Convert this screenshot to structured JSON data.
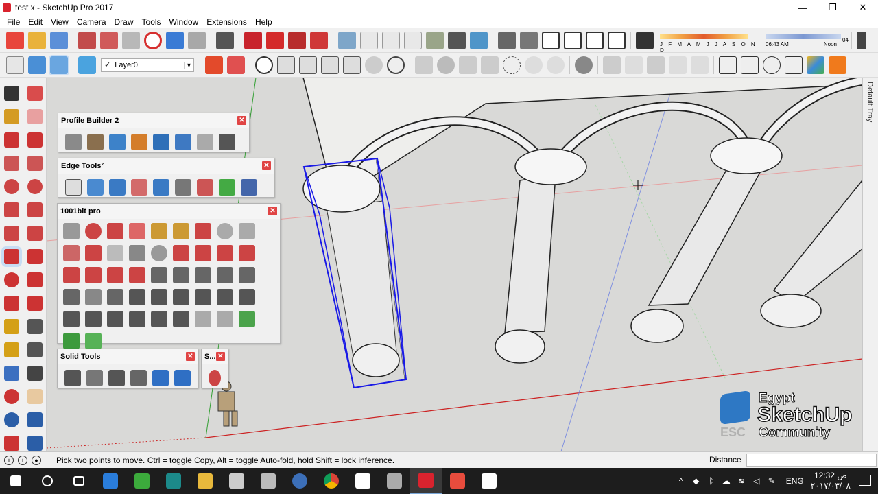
{
  "window": {
    "title": "test x - SketchUp Pro 2017",
    "controls": {
      "minimize": "—",
      "maximize": "❐",
      "close": "✕"
    }
  },
  "menu": [
    "File",
    "Edit",
    "View",
    "Camera",
    "Draw",
    "Tools",
    "Window",
    "Extensions",
    "Help"
  ],
  "toolbar1": {
    "icons": [
      "new-file",
      "open-file",
      "save-file",
      "cut",
      "copy",
      "paste",
      "erase-x",
      "undo",
      "redo",
      "print",
      "component-red-1",
      "component-red-2",
      "component-red-3",
      "component-red-4",
      "iso-view",
      "top-view",
      "front-view",
      "right-view",
      "back-view",
      "left-view",
      "xray-style",
      "wireframe-style",
      "warehouse",
      "extension-warehouse",
      "house",
      "house-2",
      "house-3",
      "house-4",
      "shadows-toggle"
    ],
    "shadow_months": "J F M A M J J A S O N D",
    "time_start": "06:43 AM",
    "time_noon": "Noon",
    "time_end": "04"
  },
  "toolbar2": {
    "layer_value": "Layer0",
    "layer_check": "✓"
  },
  "left_tools": [
    "select",
    "make-component",
    "paint-bucket",
    "eraser",
    "pencil-line",
    "freehand",
    "rectangle",
    "rotated-rectangle",
    "circle",
    "polygon",
    "arc",
    "arc-2",
    "pie",
    "arc-3",
    "move",
    "push-pull",
    "rotate",
    "follow-me",
    "scale",
    "offset",
    "tape-measure",
    "dimension",
    "protractor",
    "text",
    "axes",
    "3d-text",
    "orbit",
    "pan",
    "zoom",
    "zoom-window",
    "zoom-extents",
    "previous"
  ],
  "panels": {
    "profile_builder": {
      "title": "Profile Builder 2",
      "close": "✕"
    },
    "edge_tools": {
      "title": "Edge Tools²",
      "close": "✕"
    },
    "bit_pro": {
      "title": "1001bit pro",
      "close": "✕"
    },
    "solid_tools": {
      "title": "Solid Tools",
      "close": "✕"
    },
    "small_panel": {
      "title": "S...",
      "close": "✕"
    }
  },
  "tray": {
    "label": "Default Tray"
  },
  "status": {
    "text": "Pick two points to move.  Ctrl = toggle Copy, Alt = toggle Auto-fold, hold Shift = lock inference.",
    "measurement_label": "Distance",
    "measurement_value": ""
  },
  "taskbar": {
    "apps": [
      "windows-start",
      "cortana-search",
      "task-view",
      "edge-browser",
      "sketchup-layout",
      "style-builder",
      "file-explorer",
      "calculator",
      "store-bag",
      "search-tool",
      "chrome",
      "windows-store",
      "sketchup-printer",
      "sketchup",
      "sketchup-red",
      "image-viewer"
    ],
    "lang": "ENG",
    "time": "12:32 ص",
    "date": "٢٠١٧/٠٣/٠٨"
  },
  "watermark": {
    "line1": "Egypt",
    "line2": "SketchUp",
    "line3": "Community",
    "esc": "ESC"
  },
  "colors": {
    "selection_blue": "#1a1ae6",
    "axis_red": "#cc2222",
    "axis_green": "#33a033",
    "axis_blue": "#5566dd",
    "viewport_bg": "#d9d9d7"
  }
}
